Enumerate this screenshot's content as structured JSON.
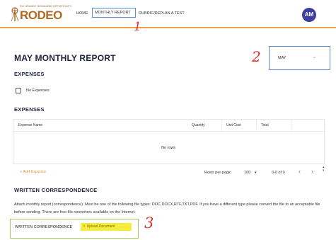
{
  "header": {
    "logo_tagline": "RIO GRANDE ORGANIZED OPPORTUNITY",
    "logo_word": "RODEO",
    "nav": [
      {
        "label": "HOME"
      },
      {
        "label": "MONTHLY REPORT"
      },
      {
        "label": "RUBRIC/REPLAN A TEST"
      }
    ],
    "avatar_initials": "AM"
  },
  "annotations": {
    "one": "1",
    "two": "2",
    "three": "3"
  },
  "page": {
    "title": "MAY MONTHLY REPORT",
    "month_select": {
      "value": "MAY"
    }
  },
  "expenses_check": {
    "heading": "EXPENSES",
    "no_expenses_label": "No Expenses"
  },
  "expenses_table": {
    "heading": "EXPENSES",
    "columns": [
      "Expense Name",
      "Quantity",
      "Unit Cost",
      "Total"
    ],
    "empty_text": "No rows",
    "add_label": "+ Add Expense",
    "rows_per_page_label": "Rows per page:",
    "rows_per_page_value": "100",
    "range_text": "0-0 of 0"
  },
  "correspondence": {
    "heading": "WRITTEN CORRESPONDENCE",
    "instructions": "Attach monthly report (correspondence). Must be one of the following file types: DOC,DOCX,RTF,TXT,PDF. If you have a different type please convert the file to an acceptable file before sending. There are free file converters available on the Internet.",
    "upload_label": "WRITTEN CORRESPONDENCE",
    "upload_button": "Upload Document"
  },
  "colors": {
    "accent": "#f0a44a",
    "avatar": "#3d3f9f",
    "annotation": "#e0332f",
    "highlight_box": "#5b8fd9",
    "upload_box": "#9fd05a",
    "upload_button": "#f6ec3c"
  }
}
